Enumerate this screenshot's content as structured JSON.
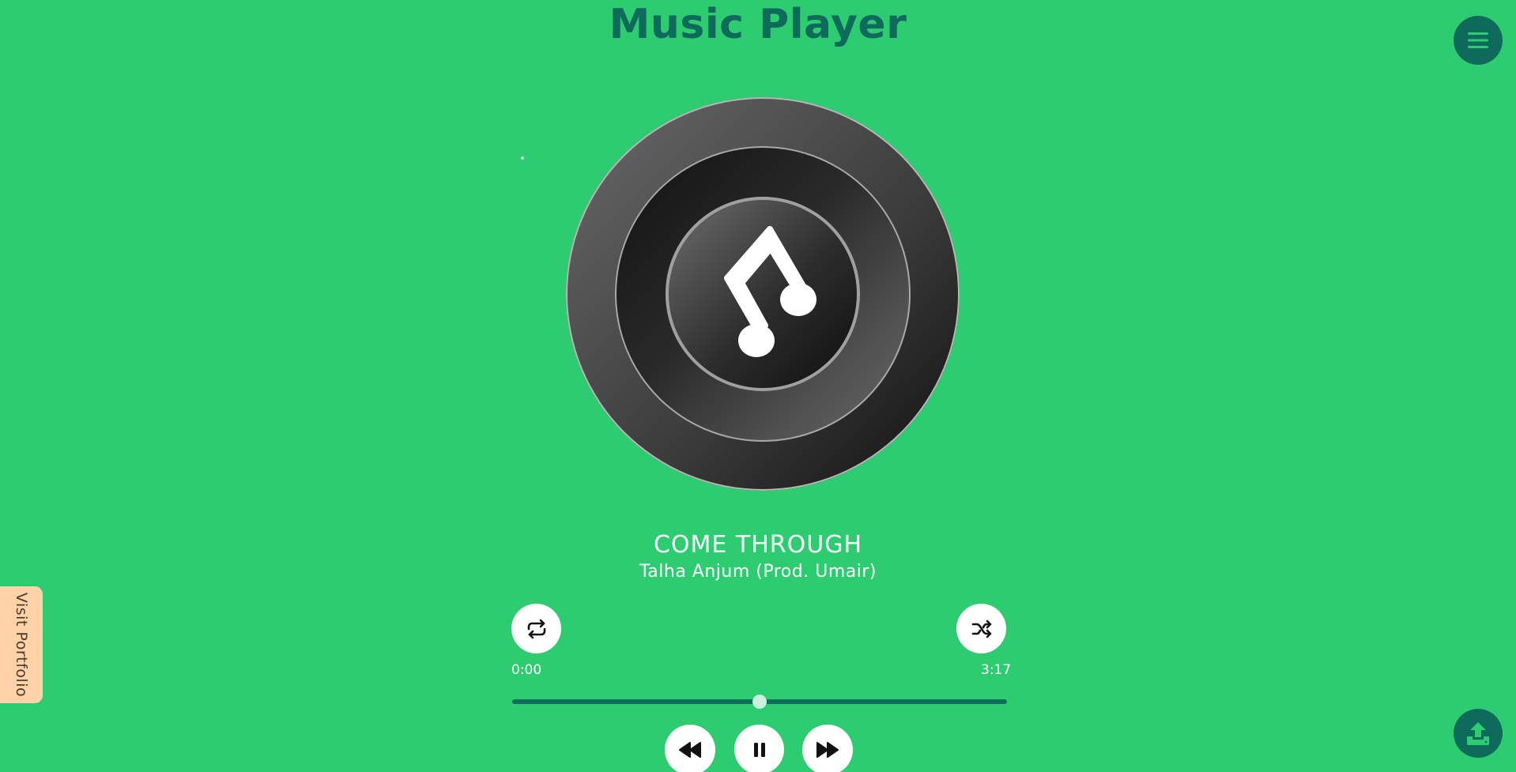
{
  "app": {
    "title": "Music Player"
  },
  "track": {
    "title": "COME THROUGH",
    "artist": "Talha Anjum (Prod. Umair)",
    "current_time": "0:00",
    "duration": "3:17",
    "progress_fraction": 0.5
  },
  "controls": {
    "repeat_icon": "repeat-icon",
    "shuffle_icon": "shuffle-icon",
    "rewind_icon": "rewind-icon",
    "pause_icon": "pause-icon",
    "forward_icon": "fast-forward-icon"
  },
  "sidebar": {
    "portfolio_label": "Visit Portfolio"
  },
  "colors": {
    "background": "#2ecc71",
    "accent_dark": "#0e6b5c",
    "portfolio_tab": "#ffd2a8",
    "text": "#ffffff"
  }
}
